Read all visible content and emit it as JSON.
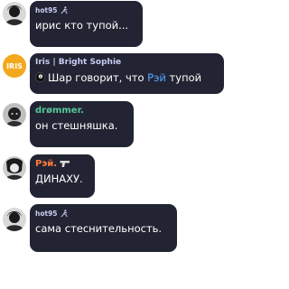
{
  "messages": [
    {
      "author": "hot95",
      "text": "ирис кто тупой..."
    },
    {
      "author": "Iris | Bright Sophie",
      "avatar_label": "IRIS",
      "text_before": "Шар говорит, что ",
      "mention": "Рэй",
      "text_after": " тупой"
    },
    {
      "author": "drømmer.",
      "text": "он стешняшка."
    },
    {
      "author": "Рэй.",
      "text": "ДИНАХУ."
    },
    {
      "author": "hot95",
      "text": "сама стеснительность."
    }
  ],
  "colors": {
    "bubble": "#232433",
    "name_default": "#c9cdf5",
    "name_dromm": "#55c89a",
    "name_rei": "#ff7a3c",
    "mention": "#5aa7ff",
    "iris_avatar": "#f2a91e"
  },
  "icons": {
    "hot95_badge": "person-running-icon",
    "iris_ball": "magic-8-ball-icon",
    "rei_badge": "gun-icon"
  }
}
